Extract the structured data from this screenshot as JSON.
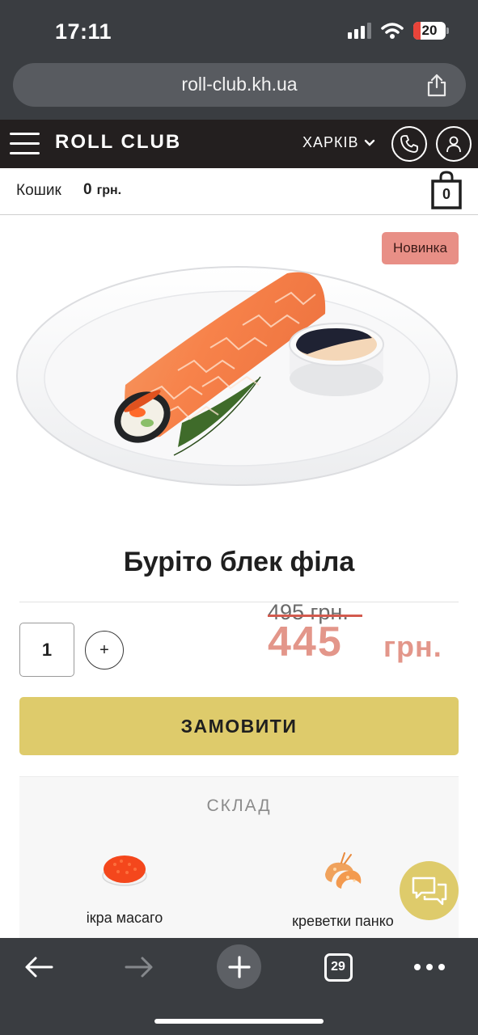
{
  "status_bar": {
    "time": "17:11",
    "battery": "20",
    "icons": [
      "signal-icon",
      "wifi-icon",
      "battery-icon"
    ]
  },
  "browser": {
    "url": "roll-club.kh.ua",
    "share_icon": "share-icon"
  },
  "site_header": {
    "menu_icon": "hamburger-icon",
    "logo": "ROLL CLUB",
    "city": "ХАРКІВ",
    "city_icon": "chevron-down-icon",
    "phone_icon": "phone-icon",
    "user_icon": "user-icon"
  },
  "cart": {
    "label": "Кошик",
    "amount": "0",
    "currency": "грн.",
    "bag_count": "0"
  },
  "product": {
    "badge": "Новинка",
    "title": "Буріто блек філа",
    "quantity": "1",
    "plus_label": "+",
    "old_price": "495 грн.",
    "price": "445",
    "currency": "грн.",
    "order_button": "ЗАМОВИТИ"
  },
  "composition": {
    "title": "СКЛАД",
    "ingredients": [
      {
        "label": "ікра масаго",
        "icon": "caviar-icon"
      },
      {
        "label": "креветки панко",
        "icon": "shrimp-icon"
      }
    ]
  },
  "toolbar": {
    "tabs_count": "29",
    "icons": [
      "back-arrow-icon",
      "forward-arrow-icon",
      "new-tab-plus-icon",
      "tabs-icon",
      "more-icon"
    ]
  },
  "colors": {
    "header_bg": "#231f1f",
    "badge": "#e88f86",
    "price": "#e3968a",
    "accent_button": "#decb6b",
    "browser_chrome": "#3a3d41"
  }
}
